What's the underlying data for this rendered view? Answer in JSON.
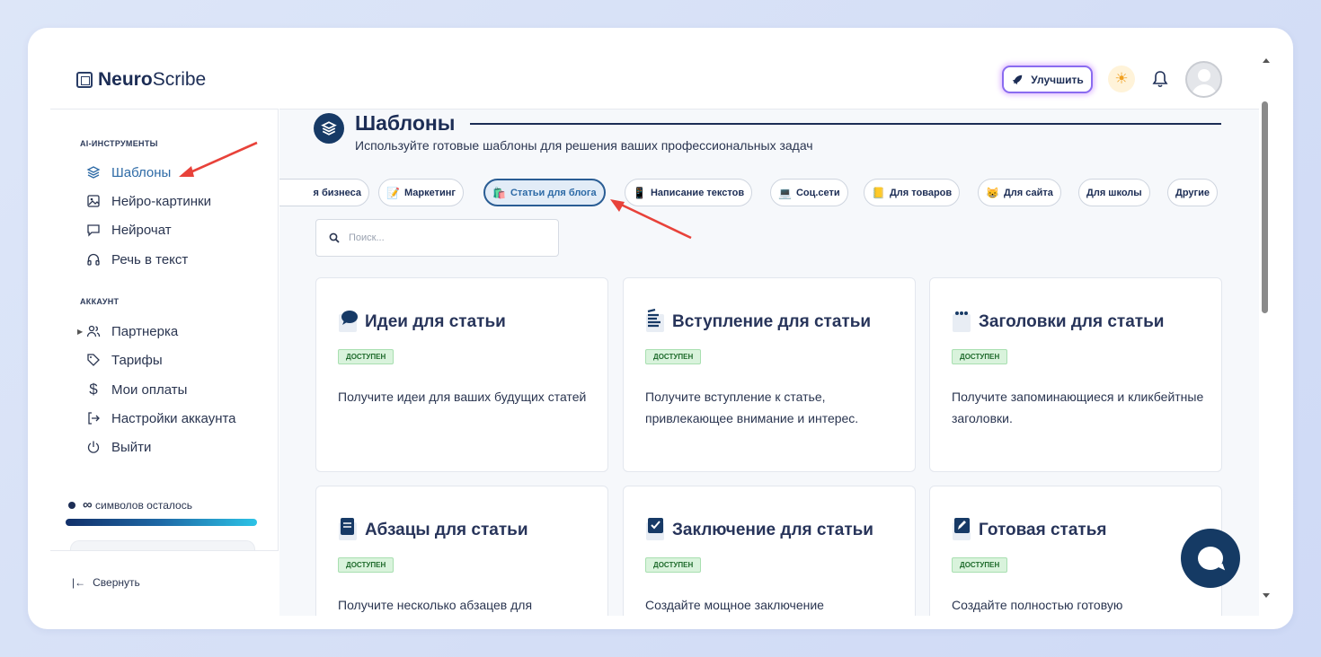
{
  "app": {
    "logo_bold": "Neuro",
    "logo_light": "Scribe"
  },
  "header": {
    "upgrade_label": "Улучшить"
  },
  "sidebar": {
    "section_ai": "AI-ИНСТРУМЕНТЫ",
    "ai_items": [
      {
        "label": "Шаблоны",
        "icon": "layers-icon"
      },
      {
        "label": "Нейро-картинки",
        "icon": "image-icon"
      },
      {
        "label": "Нейрочат",
        "icon": "chat-icon"
      },
      {
        "label": "Речь в текст",
        "icon": "headphones-icon"
      }
    ],
    "section_account": "АККАУНТ",
    "account_items": [
      {
        "label": "Партнерка",
        "icon": "users-icon"
      },
      {
        "label": "Тарифы",
        "icon": "tag-icon"
      },
      {
        "label": "Мои оплаты",
        "icon": "dollar-icon"
      },
      {
        "label": "Настройки аккаунта",
        "icon": "login-icon"
      },
      {
        "label": "Выйти",
        "icon": "power-icon"
      }
    ],
    "usage_symbol": "∞",
    "usage_text": "символов осталось",
    "collapse_label": "Свернуть"
  },
  "main": {
    "title": "Шаблоны",
    "subtitle": "Используйте готовые шаблоны для решения ваших профессиональных задач",
    "tabs": [
      {
        "label": "я бизнеса",
        "emoji": ""
      },
      {
        "label": "Маркетинг",
        "emoji": "📝"
      },
      {
        "label": "Статьи для блога",
        "emoji": "🛍️"
      },
      {
        "label": "Написание текстов",
        "emoji": "📱"
      },
      {
        "label": "Соц.сети",
        "emoji": "💻"
      },
      {
        "label": "Для товаров",
        "emoji": "📒"
      },
      {
        "label": "Для сайта",
        "emoji": "😸"
      },
      {
        "label": "Для школы",
        "emoji": ""
      },
      {
        "label": "Другие",
        "emoji": ""
      }
    ],
    "active_tab": "Статьи для блога",
    "search_placeholder": "Поиск...",
    "cards": [
      {
        "title": "Идеи для статьи",
        "badge": "ДОСТУПЕН",
        "desc": "Получите идеи для ваших будущих статей"
      },
      {
        "title": "Вступление для статьи",
        "badge": "ДОСТУПЕН",
        "desc": "Получите вступление к статье, привлекающее внимание и интерес."
      },
      {
        "title": "Заголовки для статьи",
        "badge": "ДОСТУПЕН",
        "desc": "Получите запоминающиеся и кликбейтные заголовки."
      },
      {
        "title": "Абзацы для статьи",
        "badge": "ДОСТУПЕН",
        "desc": "Получите несколько абзацев для"
      },
      {
        "title": "Заключение для статьи",
        "badge": "ДОСТУПЕН",
        "desc": "Создайте мощное заключение"
      },
      {
        "title": "Готовая статья",
        "badge": "ДОСТУПЕН",
        "desc": "Создайте полностью готовую"
      }
    ]
  },
  "colors": {
    "accent": "#2d6aa6",
    "navy": "#173a66",
    "annotation": "#e8423a",
    "badge_bg": "#d9f3dc"
  }
}
